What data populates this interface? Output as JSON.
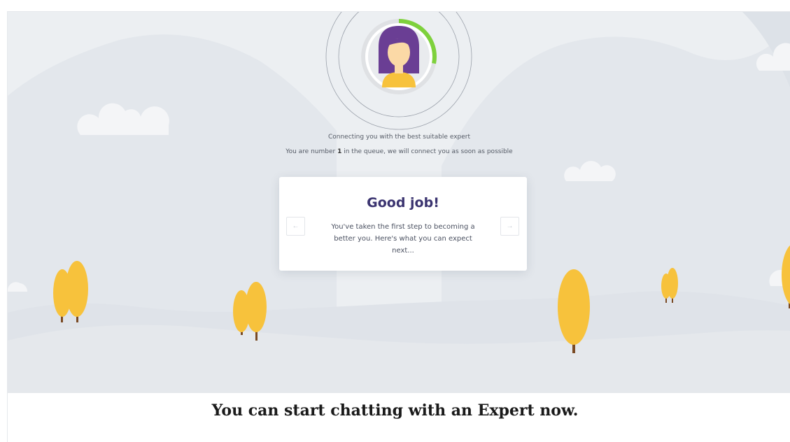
{
  "queue": {
    "line1": "Connecting you with the best suitable expert",
    "line2_prefix": "You are number",
    "position": "1",
    "line2_suffix": "in the queue, we will connect you as soon as possible",
    "progress_fraction": 0.28
  },
  "card": {
    "title": "Good job!",
    "text": "You've taken the first step to becoming a better you. Here's what you can expect next...",
    "prev_icon": "←",
    "next_icon": "→"
  },
  "headline": "You can start chatting with an Expert now.",
  "colors": {
    "progress": "#7ed13c",
    "title": "#3b3470",
    "tree": "#f7c23c",
    "avatar_hair": "#6a3e94"
  }
}
